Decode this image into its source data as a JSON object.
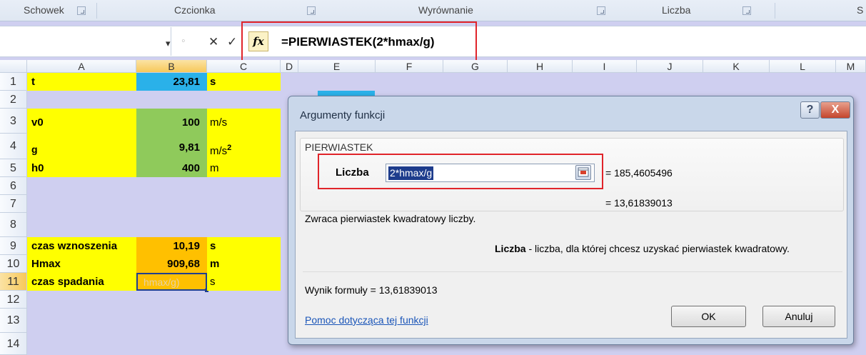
{
  "ribbon": {
    "groups": [
      "Schowek",
      "Czcionka",
      "Wyrównanie",
      "Liczba",
      "S"
    ]
  },
  "formula_bar": {
    "name_dropdown_glyph": "▾",
    "cancel_glyph": "✕",
    "enter_glyph": "✓",
    "fx_label": "fx",
    "formula": "=PIERWIASTEK(2*hmax/g)"
  },
  "columns": [
    "A",
    "B",
    "C",
    "D",
    "E",
    "F",
    "G",
    "H",
    "I",
    "J",
    "K",
    "L",
    "M"
  ],
  "rows": [
    "1",
    "2",
    "3",
    "4",
    "5",
    "6",
    "7",
    "8",
    "9",
    "10",
    "11",
    "12",
    "13",
    "14"
  ],
  "cells": {
    "t_label": "t",
    "t_value": "23,81",
    "t_unit": "s",
    "v0_label": "v0",
    "v0_value": "100",
    "v0_unit": "m/s",
    "g_label": "g",
    "g_value": "9,81",
    "g_unit": "m/s",
    "g_unit_sup": "2",
    "h0_label": "h0",
    "h0_value": "400",
    "h0_unit": "m",
    "tw_label": "czas wznoszenia",
    "tw_value": "10,19",
    "tw_unit": "s",
    "hmax_label": "Hmax",
    "hmax_value": "909,68",
    "hmax_unit": "m",
    "ts_label": "czas spadania",
    "ts_value": "hmax/g)",
    "ts_unit": "s"
  },
  "dialog": {
    "title": "Argumenty funkcji",
    "help_glyph": "?",
    "close_glyph": "X",
    "function_name": "PIERWIASTEK",
    "arg_label": "Liczba",
    "arg_value": "2*hmax/g",
    "arg_result": "=  185,4605496",
    "formula_result_eq": "=  13,61839013",
    "description": "Zwraca pierwiastek kwadratowy liczby.",
    "arg_desc_name": "Liczba",
    "arg_desc_text": " - liczba, dla której chcesz uzyskać pierwiastek kwadratowy.",
    "result_label": "Wynik formuły =  13,61839013",
    "help_link": "Pomoc dotycząca tej funkcji",
    "ok": "OK",
    "cancel": "Anuluj"
  }
}
